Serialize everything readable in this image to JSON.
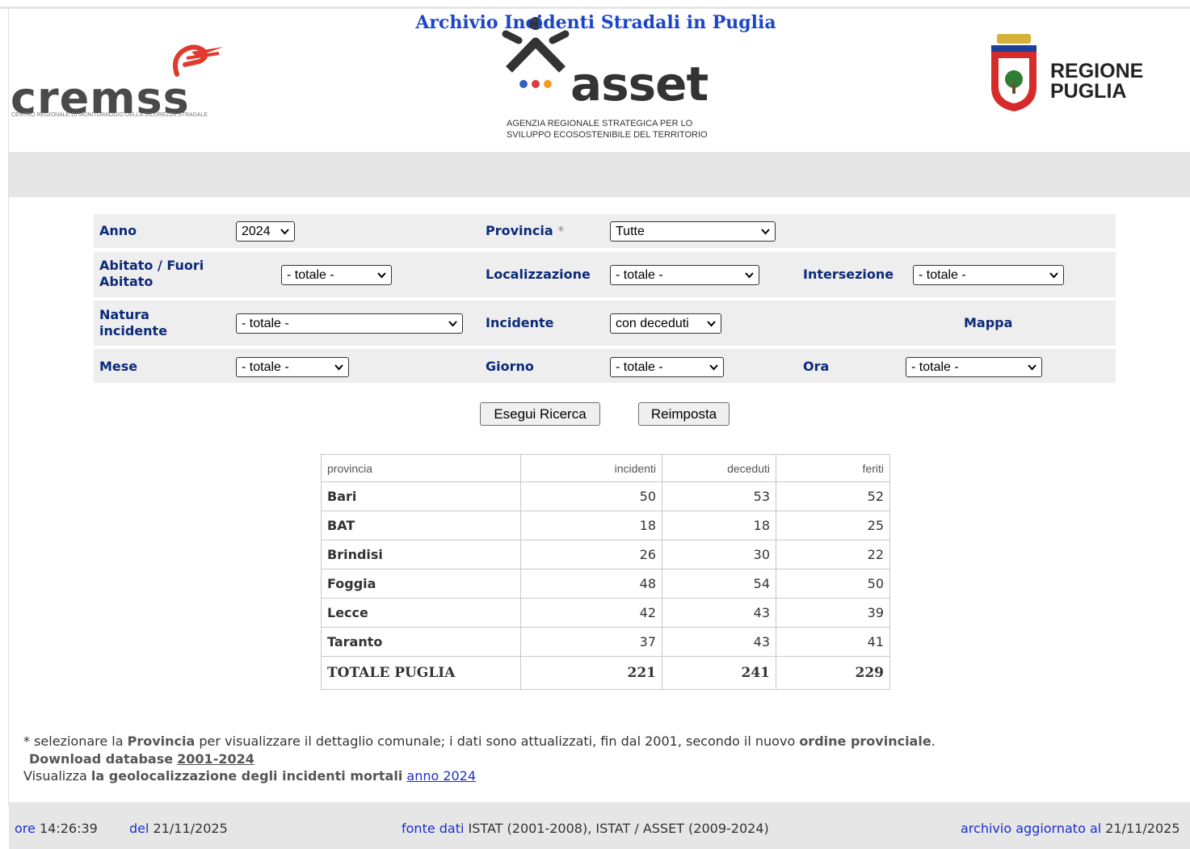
{
  "header": {
    "cremss": {
      "name": "cremss",
      "subtitle": "CENTRO REGIONALE DI MONITORAGGIO DELLA SICUREZZA STRADALE"
    },
    "asset": {
      "name": "asset",
      "subtitle_line1": "AGENZIA REGIONALE STRATEGICA PER LO",
      "subtitle_line2": "SVILUPPO ECOSOSTENIBILE DEL TERRITORIO"
    },
    "regione": {
      "line1": "REGIONE",
      "line2": "PUGLIA"
    }
  },
  "page_title": "Archivio Incidenti Stradali in Puglia",
  "filters": {
    "anno": {
      "label": "Anno",
      "value": "2024"
    },
    "provincia": {
      "label": "Provincia",
      "star": "*",
      "value": "Tutte"
    },
    "abitato": {
      "label_line1": "Abitato / Fuori",
      "label_line2": "Abitato",
      "value": "- totale -"
    },
    "localizzazione": {
      "label": "Localizzazione",
      "value": "- totale -"
    },
    "intersezione": {
      "label": "Intersezione",
      "value": "- totale -"
    },
    "natura": {
      "label_line1": "Natura",
      "label_line2": "incidente",
      "value": "- totale -"
    },
    "incidente": {
      "label": "Incidente",
      "value": "con deceduti"
    },
    "mappa": {
      "label": "Mappa"
    },
    "mese": {
      "label": "Mese",
      "value": "- totale -"
    },
    "giorno": {
      "label": "Giorno",
      "value": "- totale -"
    },
    "ora": {
      "label": "Ora",
      "value": "- totale -"
    }
  },
  "buttons": {
    "search": "Esegui Ricerca",
    "reset": "Reimposta"
  },
  "table": {
    "headers": [
      "provincia",
      "incidenti",
      "deceduti",
      "feriti"
    ],
    "rows": [
      {
        "provincia": "Bari",
        "incidenti": "50",
        "deceduti": "53",
        "feriti": "52"
      },
      {
        "provincia": "BAT",
        "incidenti": "18",
        "deceduti": "18",
        "feriti": "25"
      },
      {
        "provincia": "Brindisi",
        "incidenti": "26",
        "deceduti": "30",
        "feriti": "22"
      },
      {
        "provincia": "Foggia",
        "incidenti": "48",
        "deceduti": "54",
        "feriti": "50"
      },
      {
        "provincia": "Lecce",
        "incidenti": "42",
        "deceduti": "43",
        "feriti": "39"
      },
      {
        "provincia": "Taranto",
        "incidenti": "37",
        "deceduti": "43",
        "feriti": "41"
      }
    ],
    "total": {
      "provincia": "TOTALE PUGLIA",
      "incidenti": "221",
      "deceduti": "241",
      "feriti": "229"
    }
  },
  "notes": {
    "line1_a": "* selezionare la ",
    "line1_b": "Provincia",
    "line1_c": " per visualizzare il dettaglio comunale; i dati sono attualizzati, fin dal 2001, secondo il nuovo ",
    "line1_d": "ordine provinciale",
    "line1_e": ".",
    "download_label": "Download database",
    "download_link": "2001-2024",
    "geo_a": "Visualizza ",
    "geo_b": "la geolocalizzazione degli incidenti mortali",
    "geo_link": "anno 2024"
  },
  "footer": {
    "ore_label": "ore",
    "time": "14:26:39",
    "del_label": "del",
    "date": "21/11/2025",
    "fonte_label": "fonte dati",
    "fonte_value": "ISTAT (2001-2008), ISTAT / ASSET (2009-2024)",
    "aggiornato_label": "archivio aggiornato al",
    "aggiornato_date": "21/11/2025"
  },
  "colors": {
    "title_blue": "#1b46c8",
    "label_navy": "#0c2a7a",
    "link_blue": "#1a30c8",
    "band_gray": "#e6e6e6",
    "cremss_red": "#e03a2f"
  }
}
